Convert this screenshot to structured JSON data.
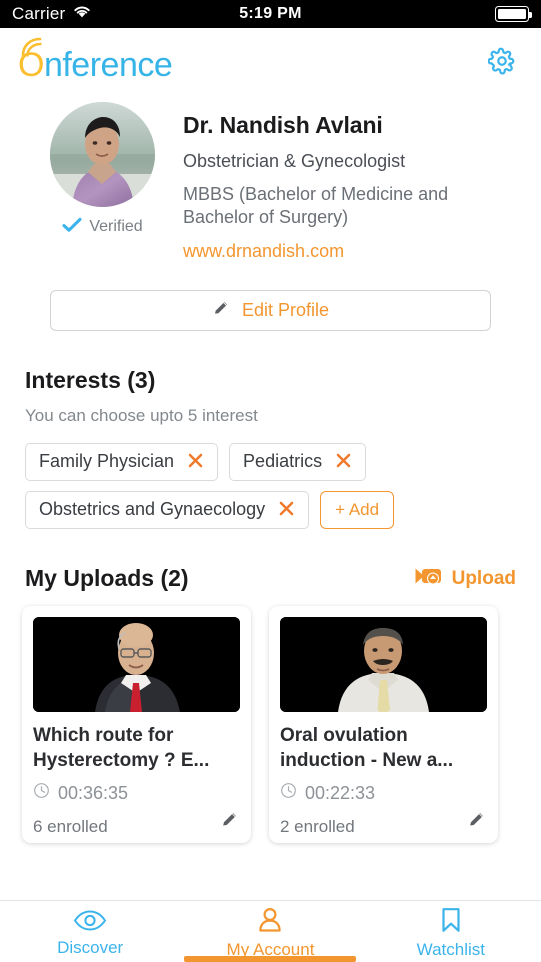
{
  "status_bar": {
    "carrier": "Carrier",
    "wifi_icon": "wifi-icon",
    "time": "5:19 PM",
    "battery_icon": "battery-full-icon"
  },
  "header": {
    "logo_first": "O",
    "logo_rest": "nference",
    "logo_arc_icon": "wifi-arcs-icon",
    "settings_icon": "gear-icon",
    "colors": {
      "logo_o": "#FBBE2E",
      "logo_text": "#36B4E8",
      "gear": "#3BB4EC"
    }
  },
  "profile": {
    "avatar_icon": "user-avatar-photo",
    "verified_icon": "check-icon",
    "verified_label": "Verified",
    "name": "Dr. Nandish Avlani",
    "specialty": "Obstetrician & Gynecologist",
    "degree": "MBBS (Bachelor of Medicine and Bachelor of Surgery)",
    "website": "www.drnandish.com",
    "edit_profile": {
      "label": "Edit Profile",
      "icon": "pencil-icon"
    }
  },
  "interests": {
    "title": "Interests (3)",
    "subtitle": "You can choose upto 5 interest",
    "items": [
      {
        "label": "Family Physician",
        "remove_icon": "close-x-icon"
      },
      {
        "label": "Pediatrics",
        "remove_icon": "close-x-icon"
      },
      {
        "label": "Obstetrics and Gynaecology",
        "remove_icon": "close-x-icon"
      }
    ],
    "add_label": "+ Add"
  },
  "uploads": {
    "title": "My Uploads (2)",
    "upload_button": {
      "label": "Upload",
      "icon": "video-upload-icon"
    },
    "cards": [
      {
        "thumbnail_icon": "video-thumbnail-speaker-1",
        "title": "Which route for Hysterectomy ? E...",
        "duration_icon": "clock-icon",
        "duration": "00:36:35",
        "enrolled": "6 enrolled",
        "edit_icon": "pencil-icon"
      },
      {
        "thumbnail_icon": "video-thumbnail-speaker-2",
        "title": "Oral ovulation induction - New a...",
        "duration_icon": "clock-icon",
        "duration": "00:22:33",
        "enrolled": "2 enrolled",
        "edit_icon": "pencil-icon"
      }
    ]
  },
  "tabbar": {
    "tabs": [
      {
        "label": "Discover",
        "icon": "eye-icon",
        "active": false
      },
      {
        "label": "My Account",
        "icon": "person-icon",
        "active": true
      },
      {
        "label": "Watchlist",
        "icon": "bookmark-icon",
        "active": false
      }
    ],
    "colors": {
      "active": "#F3962F",
      "inactive": "#3BB4EC"
    }
  }
}
